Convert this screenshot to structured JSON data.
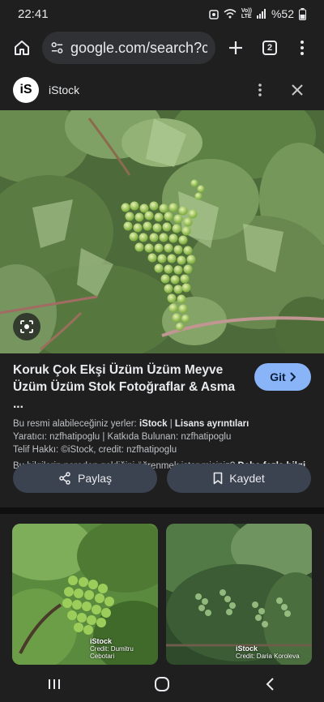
{
  "status": {
    "time": "22:41",
    "network": "Vo))\nLTE",
    "battery": "%52"
  },
  "browser": {
    "url": "google.com/search?cli",
    "tab_count": "2"
  },
  "source": {
    "name": "iStock",
    "logo": "iS"
  },
  "result": {
    "title": "Koruk Çok Ekşi Üzüm Üzüm Meyve Üzüm Üzüm Stok Fotoğraflar & Asma ...",
    "visit_label": "Git",
    "available_prefix": "Bu resmi alabileceğiniz yerler:",
    "available_source": "iStock",
    "available_sep": "|",
    "license_link": "Lisans ayrıntıları",
    "creator": "Yaratıcı: nzfhatipoglu | Katkıda Bulunan: nzfhatipoglu",
    "copyright": "Telif Hakkı: ©iStock, credit: nzfhatipoglu",
    "question": "Bu bilgilerin nereden geldiğini öğrenmek ister misiniz?",
    "more_info": "Daha fazla bilgi"
  },
  "actions": {
    "share_label": "Paylaş",
    "save_label": "Kaydet"
  },
  "related": [
    {
      "brand": "iStock",
      "credit": "Credit: Dumitru Cebotari"
    },
    {
      "brand": "iStock",
      "credit": "Credit: Daria Koroleva"
    }
  ],
  "icons": [
    "home-icon",
    "site-info-icon",
    "plus-icon",
    "tabs-icon",
    "more-vert-icon",
    "close-icon",
    "lens-icon",
    "chevron-right-icon",
    "share-icon",
    "bookmark-icon",
    "recent-apps-icon",
    "home-circle-icon",
    "back-icon"
  ],
  "colors": {
    "background": "#1f1f1f",
    "accent": "#8ab4f8",
    "pill": "#3c4350"
  }
}
